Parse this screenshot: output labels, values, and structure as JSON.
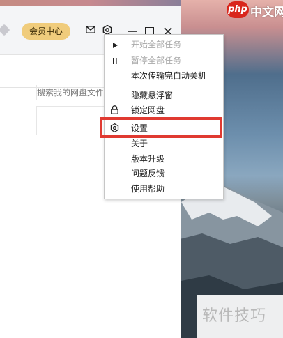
{
  "header": {
    "vip_label": "会员中心"
  },
  "search": {
    "placeholder": "搜索我的网盘文件"
  },
  "context_menu": {
    "items": [
      {
        "label": "开始全部任务",
        "icon": "play-icon",
        "disabled": true
      },
      {
        "label": "暂停全部任务",
        "icon": "pause-icon",
        "disabled": true
      },
      {
        "label": "本次传输完自动关机",
        "icon": "",
        "disabled": false
      },
      {
        "label": "隐藏悬浮窗",
        "icon": "",
        "disabled": false
      },
      {
        "label": "锁定网盘",
        "icon": "lock-icon",
        "disabled": false
      },
      {
        "label": "设置",
        "icon": "gear-icon",
        "disabled": false,
        "highlighted": true
      },
      {
        "label": "关于",
        "icon": "",
        "disabled": false
      },
      {
        "label": "版本升级",
        "icon": "",
        "disabled": false
      },
      {
        "label": "问题反馈",
        "icon": "",
        "disabled": false
      },
      {
        "label": "使用帮助",
        "icon": "",
        "disabled": false
      }
    ]
  },
  "watermarks": {
    "php_badge": "php",
    "php_site": "中文网",
    "bottom_right": "软件技巧"
  },
  "colors": {
    "highlight_border": "#e03a31",
    "vip_button": "#f0cc7c",
    "php_red": "#d9261c"
  }
}
